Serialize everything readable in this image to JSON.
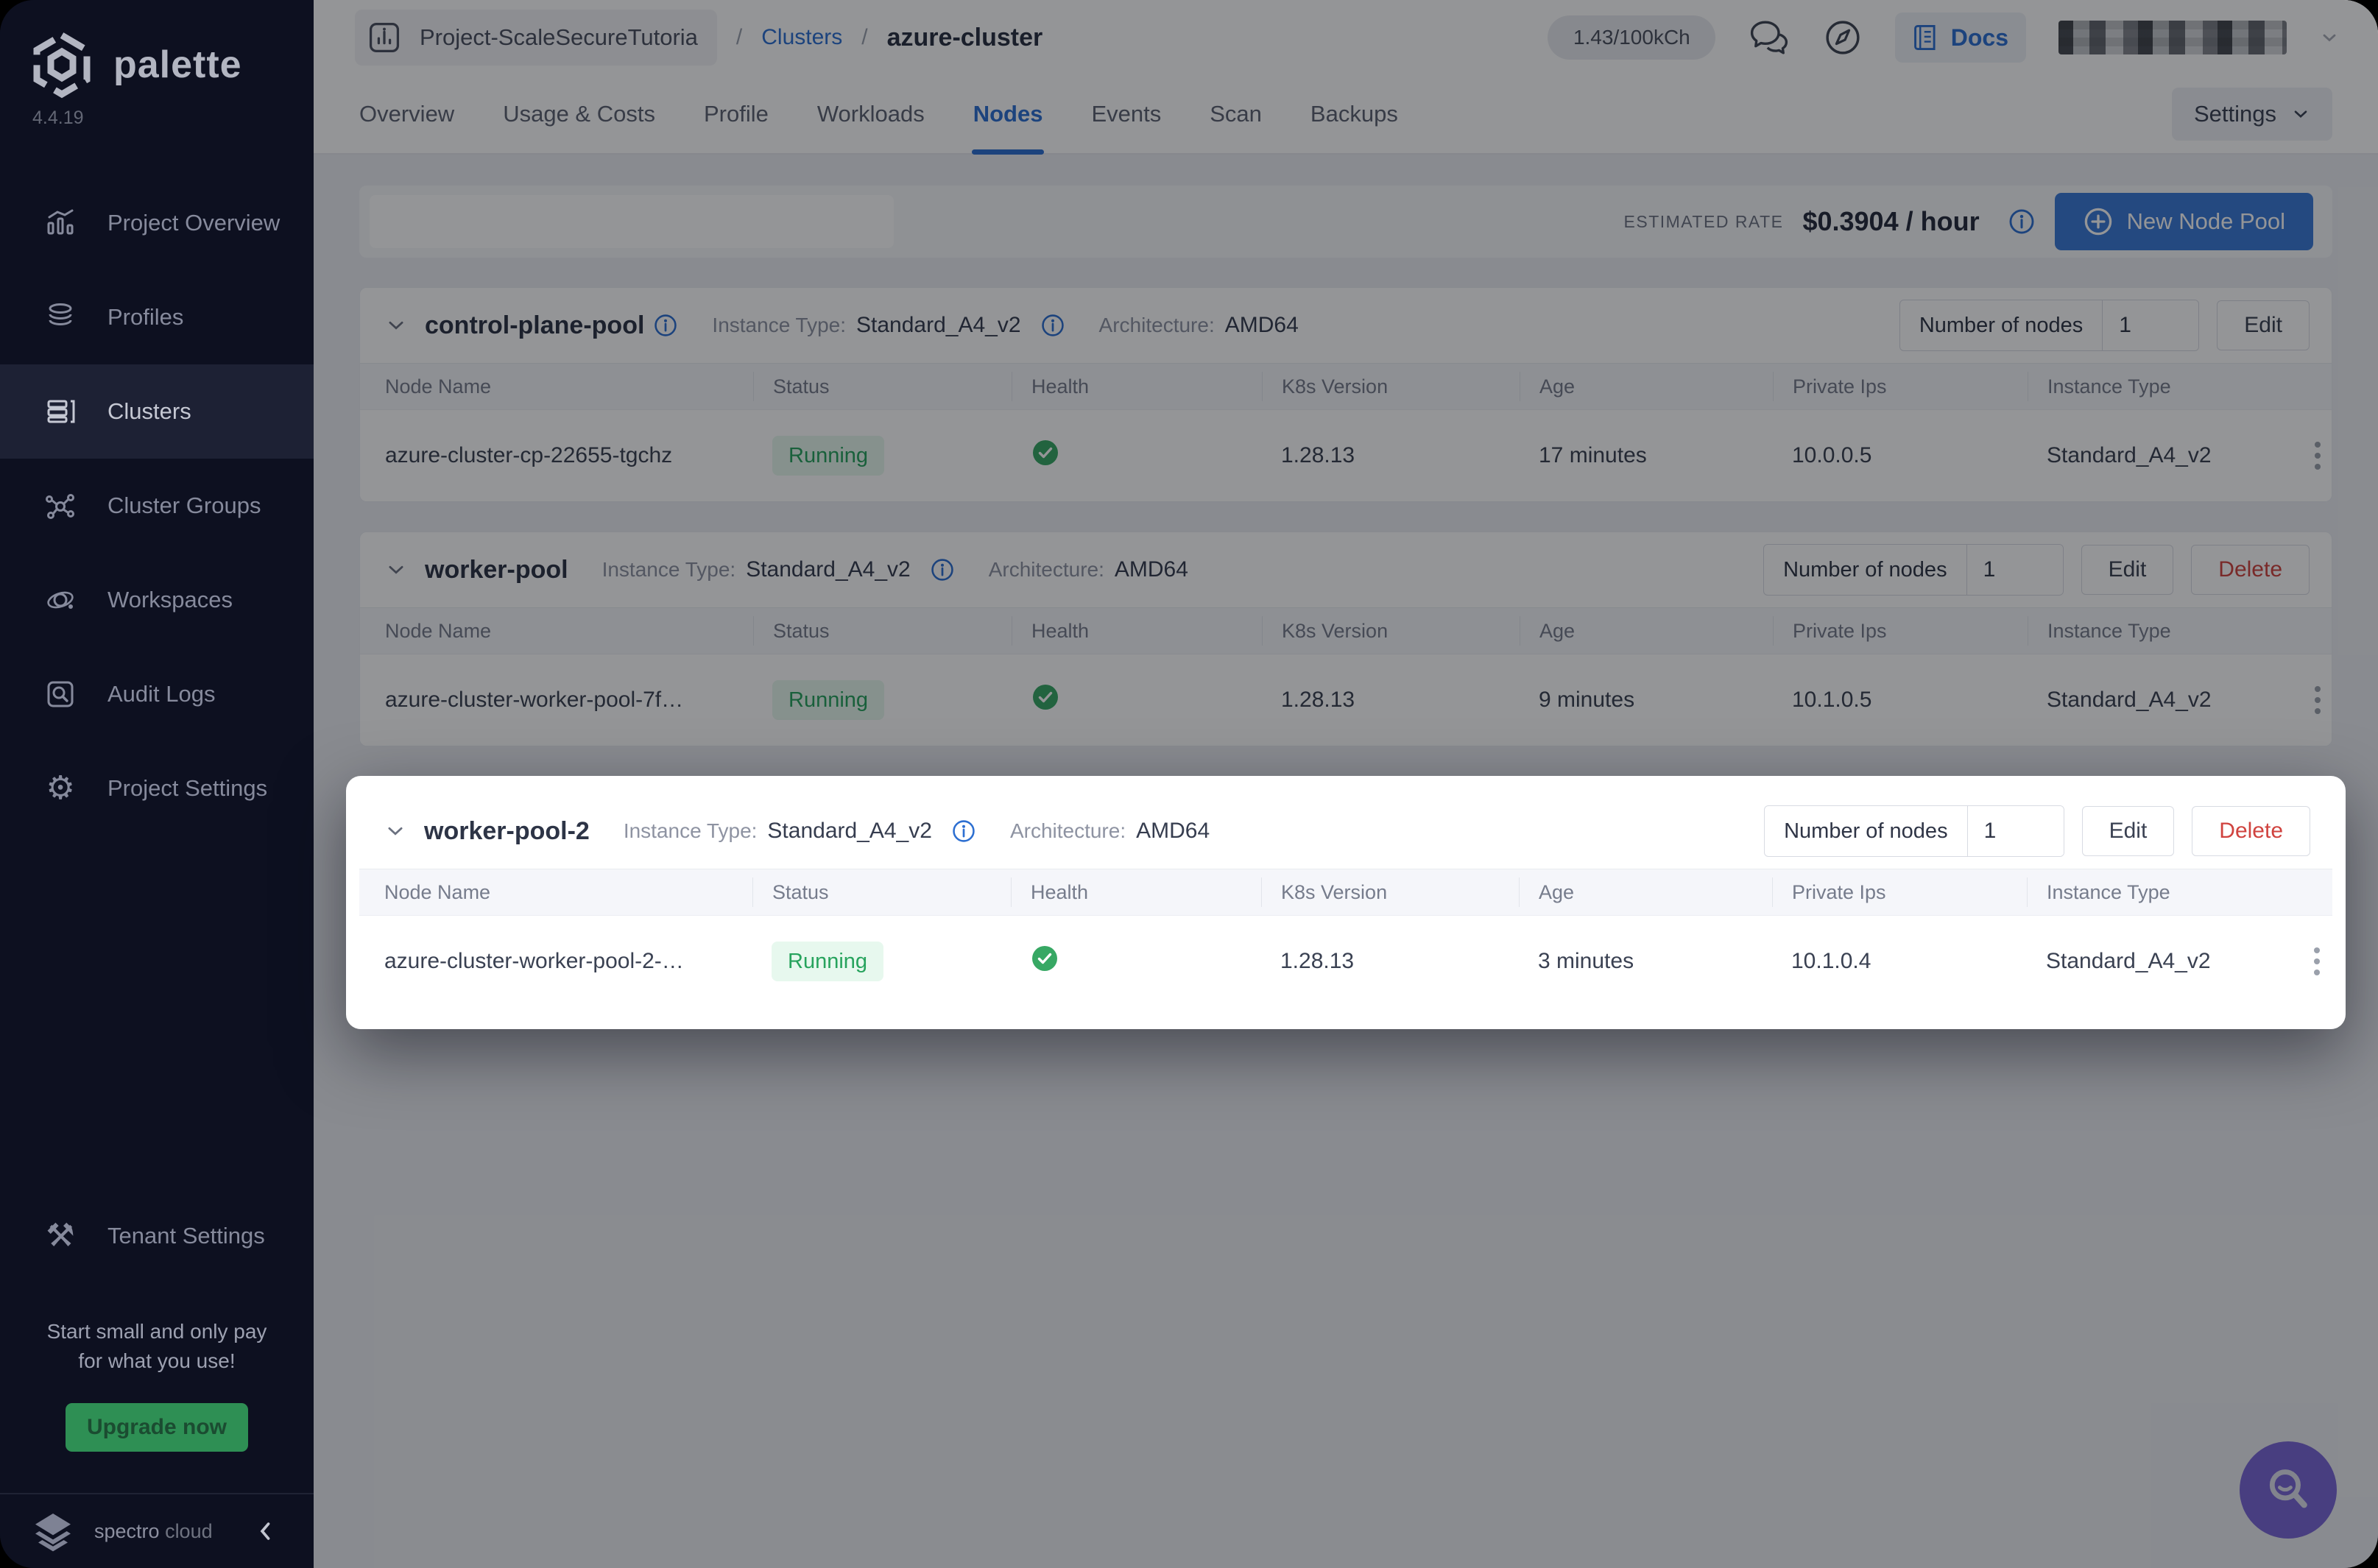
{
  "app": {
    "brand": "palette",
    "version": "4.4.19",
    "footer_brand_1": "spectro",
    "footer_brand_2": "cloud",
    "accent_blue": "#2d6fd1",
    "success_green": "#27a35d",
    "danger_red": "#d0433f",
    "upgrade_green": "#2e8f54",
    "fab_purple": "#7a66d6"
  },
  "sidebar": {
    "items": [
      {
        "label": "Project Overview"
      },
      {
        "label": "Profiles"
      },
      {
        "label": "Clusters"
      },
      {
        "label": "Cluster Groups"
      },
      {
        "label": "Workspaces"
      },
      {
        "label": "Audit Logs"
      },
      {
        "label": "Project Settings"
      }
    ],
    "tenant_settings": "Tenant Settings",
    "tagline_line1": "Start small and only pay",
    "tagline_line2": "for what you use!",
    "upgrade_label": "Upgrade now"
  },
  "topbar": {
    "project": "Project-ScaleSecureTutoria",
    "sep": "/",
    "crumb_clusters": "Clusters",
    "crumb_current": "azure-cluster",
    "credits": "1.43/100kCh",
    "docs_label": "Docs"
  },
  "tabs": {
    "items": [
      "Overview",
      "Usage & Costs",
      "Profile",
      "Workloads",
      "Nodes",
      "Events",
      "Scan",
      "Backups"
    ],
    "active": "Nodes",
    "settings_label": "Settings"
  },
  "toolbar": {
    "estimated_rate_label": "ESTIMATED RATE",
    "rate_value": "$0.3904 / hour",
    "new_node_pool_label": "New Node Pool"
  },
  "nodes_table": {
    "columns": [
      "Node Name",
      "Status",
      "Health",
      "K8s Version",
      "Age",
      "Private Ips",
      "Instance Type"
    ]
  },
  "pools": [
    {
      "name": "control-plane-pool",
      "instance_type_label": "Instance Type:",
      "instance_type": "Standard_A4_v2",
      "architecture_label": "Architecture:",
      "architecture": "AMD64",
      "nodes_label": "Number of nodes",
      "nodes_value": "1",
      "edit_label": "Edit",
      "row": {
        "name": "azure-cluster-cp-22655-tgchz",
        "status": "Running",
        "k8s": "1.28.13",
        "age": "17 minutes",
        "ip": "10.0.0.5",
        "instance": "Standard_A4_v2"
      }
    },
    {
      "name": "worker-pool",
      "instance_type_label": "Instance Type:",
      "instance_type": "Standard_A4_v2",
      "architecture_label": "Architecture:",
      "architecture": "AMD64",
      "nodes_label": "Number of nodes",
      "nodes_value": "1",
      "edit_label": "Edit",
      "delete_label": "Delete",
      "row": {
        "name": "azure-cluster-worker-pool-7f…",
        "status": "Running",
        "k8s": "1.28.13",
        "age": "9 minutes",
        "ip": "10.1.0.5",
        "instance": "Standard_A4_v2"
      }
    },
    {
      "name": "worker-pool-2",
      "instance_type_label": "Instance Type:",
      "instance_type": "Standard_A4_v2",
      "architecture_label": "Architecture:",
      "architecture": "AMD64",
      "nodes_label": "Number of nodes",
      "nodes_value": "1",
      "edit_label": "Edit",
      "delete_label": "Delete",
      "row": {
        "name": "azure-cluster-worker-pool-2-…",
        "status": "Running",
        "k8s": "1.28.13",
        "age": "3 minutes",
        "ip": "10.1.0.4",
        "instance": "Standard_A4_v2"
      }
    }
  ]
}
